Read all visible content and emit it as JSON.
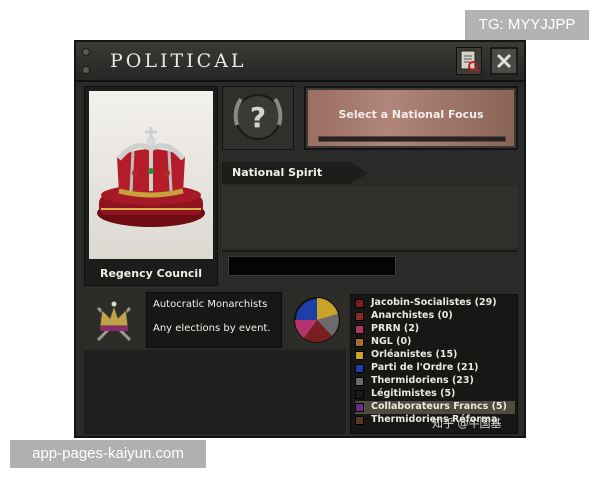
{
  "window": {
    "title": "POLITICAL"
  },
  "leader": {
    "name": "Regency Council"
  },
  "focus": {
    "label": "Select a National Focus",
    "progress": 0
  },
  "national_spirit": {
    "header": "National Spirit"
  },
  "ruling_party": {
    "name": "Autocratic Monarchists",
    "election_text": "Any elections by event."
  },
  "parties": [
    {
      "label": "Jacobin-Socialistes (29)",
      "color": "#7a1f1f"
    },
    {
      "label": "Anarchistes (0)",
      "color": "#8c2a2a"
    },
    {
      "label": "PRRN (2)",
      "color": "#b3356e"
    },
    {
      "label": "NGL (0)",
      "color": "#a8702a"
    },
    {
      "label": "Orléanistes (15)",
      "color": "#c9a227"
    },
    {
      "label": "Parti de l'Ordre (21)",
      "color": "#1f3fa8"
    },
    {
      "label": "Thermidoriens (23)",
      "color": "#6b6b6b"
    },
    {
      "label": "Légitimistes (5)",
      "color": "#1a1a1a"
    },
    {
      "label": "Collaborateurs Francs (5)",
      "color": "#6a2a8a"
    },
    {
      "label": "Thermidoriens Réforma",
      "color": "#5a3a1a"
    }
  ],
  "icons": {
    "ledger": "ledger-icon",
    "close": "close-icon",
    "ideology": "question-mark-icon",
    "portrait": "crown-icon",
    "party": "crown-emblem-icon",
    "popularity": "pie-chart-icon"
  },
  "watermarks": {
    "top": "TG: MYYJJPP",
    "bottom": "app-pages-kaiyun.com",
    "cn": "知乎 @牛国基"
  }
}
